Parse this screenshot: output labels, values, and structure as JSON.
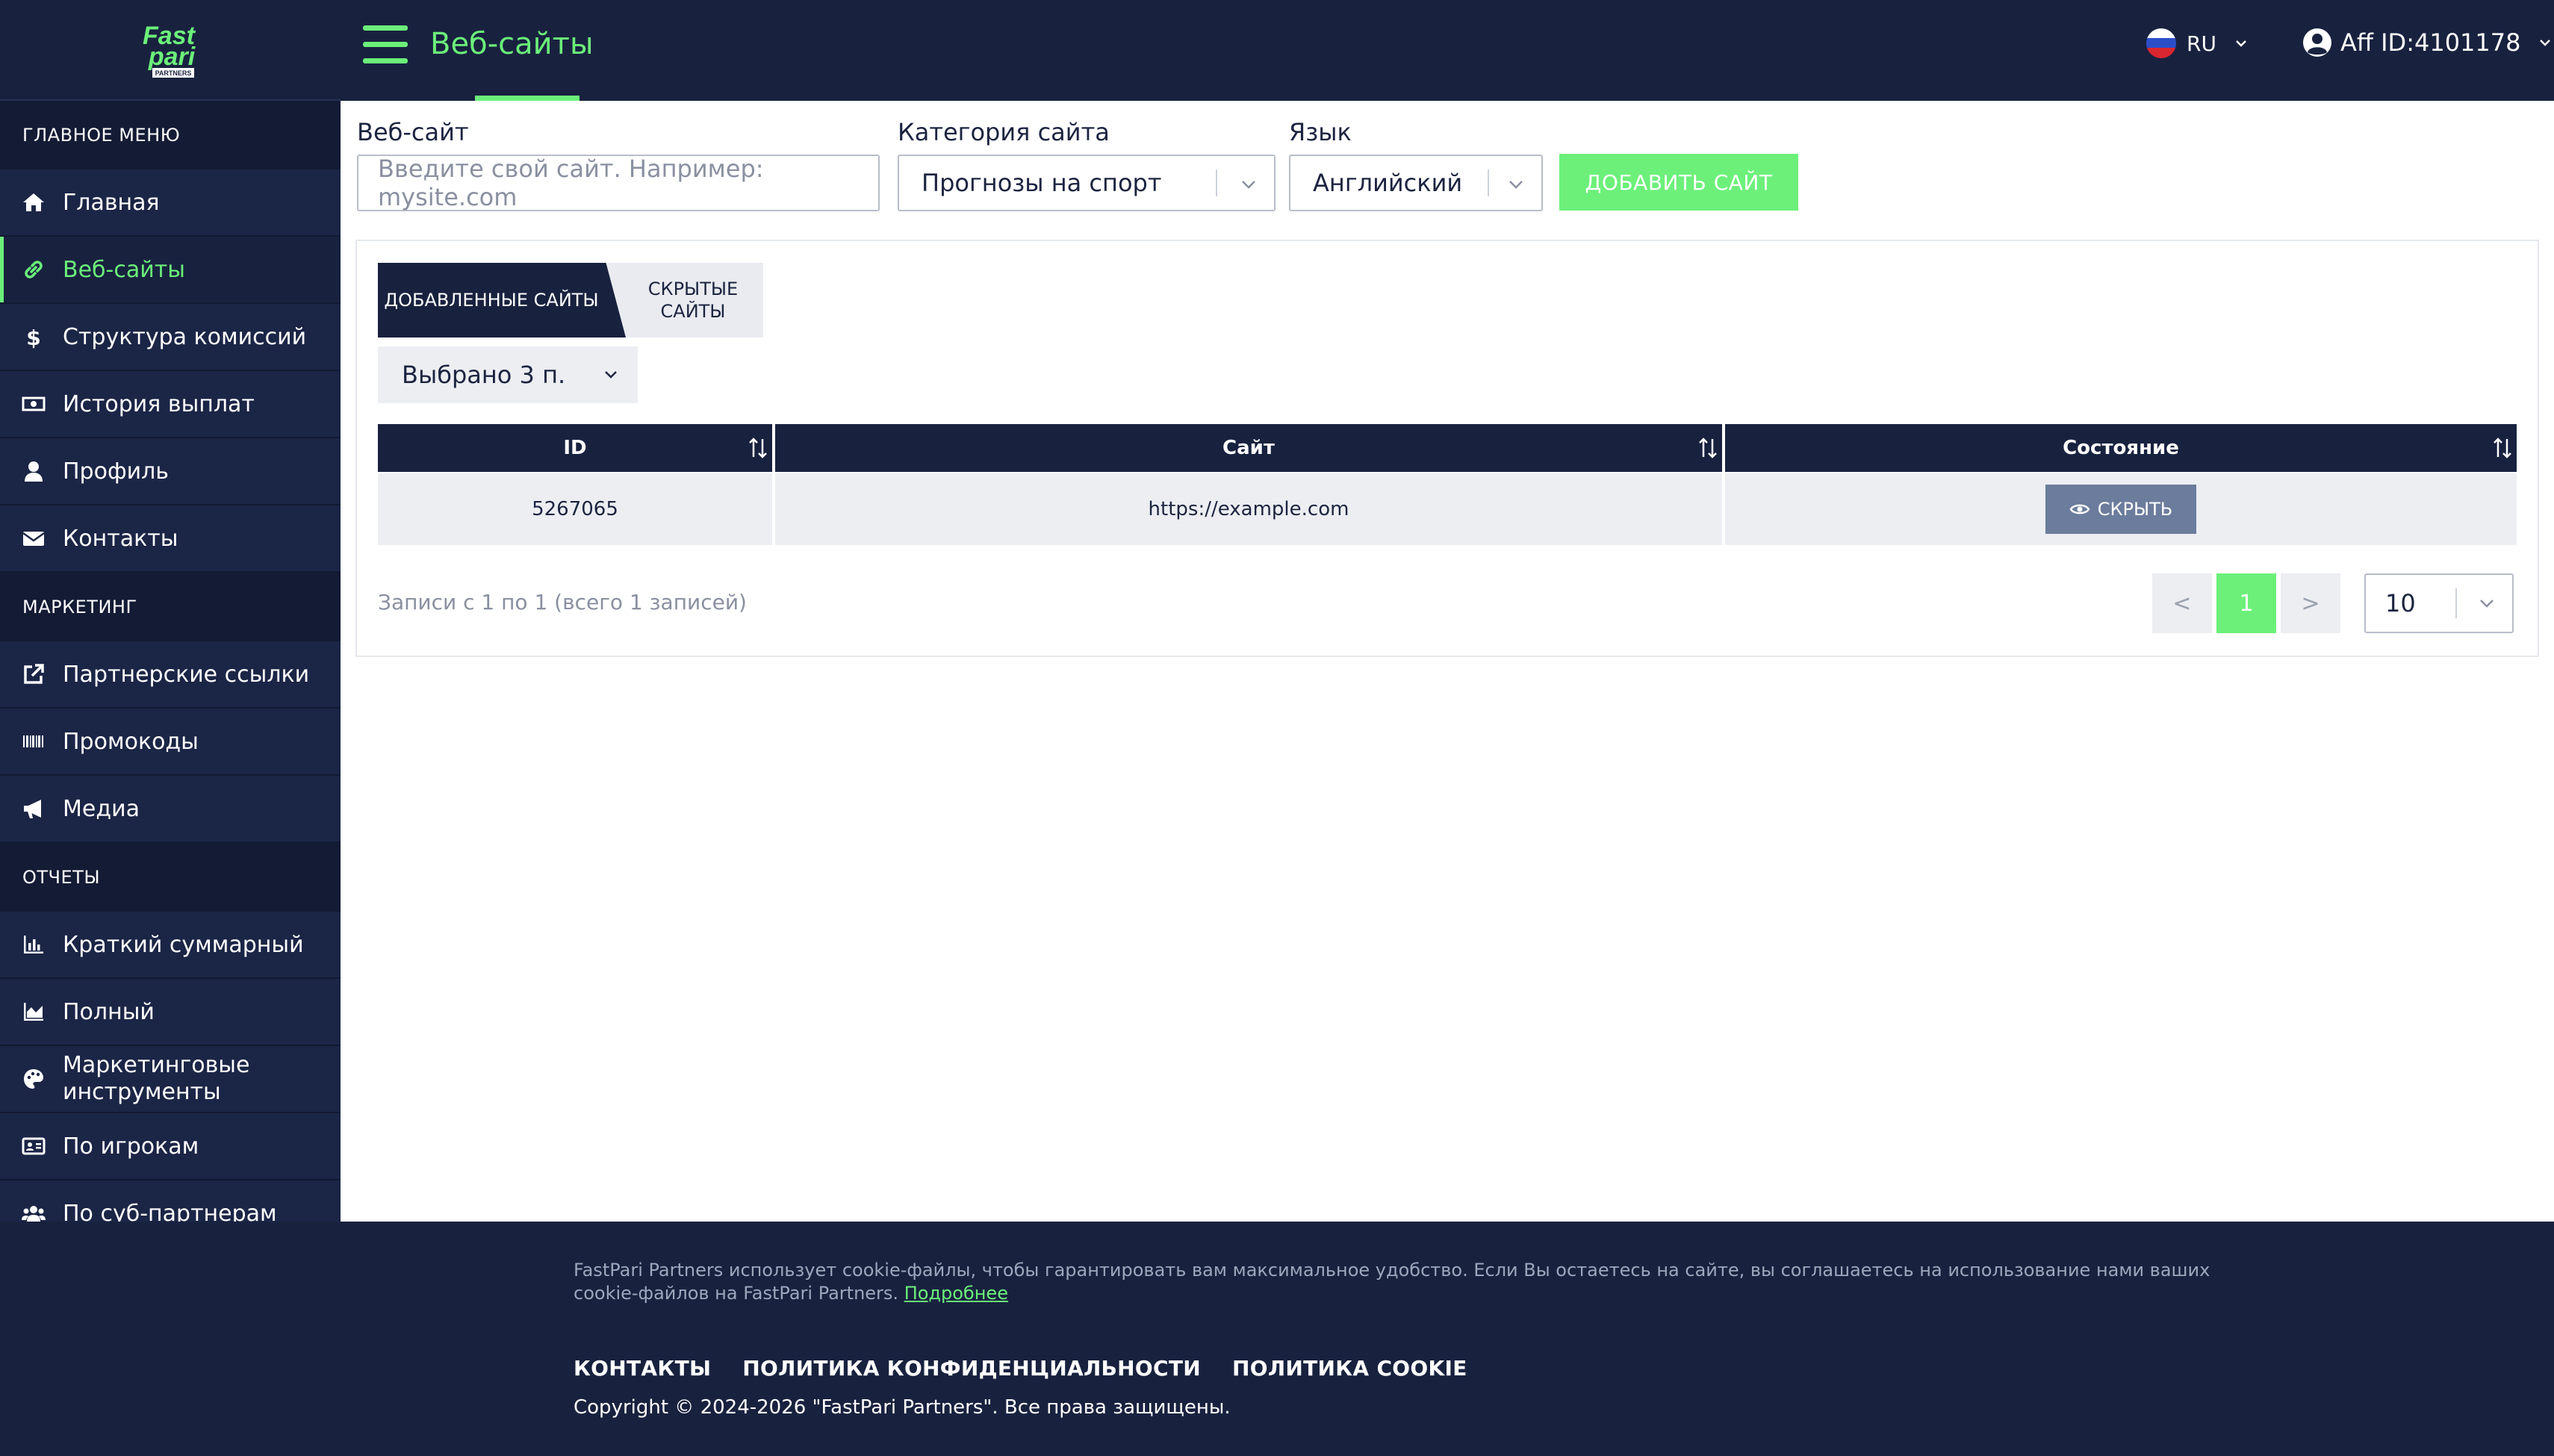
{
  "brand": {
    "logo_top": "Fast",
    "logo_bottom": "pari",
    "logo_sub": "PARTNERS",
    "accent_color": "#6cf07a",
    "dark_color": "#18223f"
  },
  "header": {
    "title": "Веб-сайты",
    "language": "RU",
    "affiliate": "Aff ID:4101178"
  },
  "sidebar": {
    "main_heading": "ГЛАВНОЕ МЕНЮ",
    "main_items": [
      {
        "label": "Главная",
        "icon": "home-icon"
      },
      {
        "label": "Веб-сайты",
        "icon": "link-icon",
        "active": true
      },
      {
        "label": "Структура комиссий",
        "icon": "dollar-icon"
      },
      {
        "label": "История выплат",
        "icon": "money-icon"
      },
      {
        "label": "Профиль",
        "icon": "user-icon"
      },
      {
        "label": "Контакты",
        "icon": "envelope-icon"
      }
    ],
    "marketing_heading": "МАРКЕТИНГ",
    "marketing_items": [
      {
        "label": "Партнерские ссылки",
        "icon": "external-link-icon"
      },
      {
        "label": "Промокоды",
        "icon": "barcode-icon"
      },
      {
        "label": "Медиа",
        "icon": "megaphone-icon"
      }
    ],
    "reports_heading": "ОТЧЕТЫ",
    "reports_items": [
      {
        "label": "Краткий суммарный",
        "icon": "bar-chart-icon"
      },
      {
        "label": "Полный",
        "icon": "area-chart-icon"
      },
      {
        "label": "Маркетинговые инструменты",
        "icon": "palette-icon"
      },
      {
        "label": "По игрокам",
        "icon": "id-card-icon"
      },
      {
        "label": "По суб-партнерам",
        "icon": "users-icon"
      }
    ]
  },
  "form": {
    "website_label": "Веб-сайт",
    "website_placeholder": "Введите свой сайт. Например: mysite.com",
    "category_label": "Категория сайта",
    "category_value": "Прогнозы на спорт",
    "language_label": "Язык",
    "language_value": "Английский",
    "add_button": "ДОБАВИТЬ САЙТ"
  },
  "tabs": {
    "added": "ДОБАВЛЕННЫЕ САЙТЫ",
    "hidden": "СКРЫТЫЕ САЙТЫ"
  },
  "column_selector": "Выбрано 3 п.",
  "table": {
    "columns": [
      "ID",
      "Сайт",
      "Состояние"
    ],
    "rows": [
      {
        "id": "5267065",
        "site": "https://example.com",
        "action": "СКРЫТЬ"
      }
    ]
  },
  "pagination": {
    "records": "Записи с 1 по 1 (всего 1 записей)",
    "prev": "<",
    "current": "1",
    "next": ">",
    "page_size": "10"
  },
  "footer": {
    "cookie_text": "FastPari Partners использует cookie-файлы, чтобы гарантировать вам максимальное удобство. Если Вы остаетесь на сайте, вы соглашаетесь на использование нами ваших cookie-файлов на FastPari Partners.",
    "cookie_link": "Подробнее",
    "links": [
      "КОНТАКТЫ",
      "ПОЛИТИКА КОНФИДЕНЦИАЛЬНОСТИ",
      "ПОЛИТИКА COOKIE"
    ],
    "copyright": "Copyright © 2024-2026 \"FastPari Partners\". Все права защищены."
  }
}
